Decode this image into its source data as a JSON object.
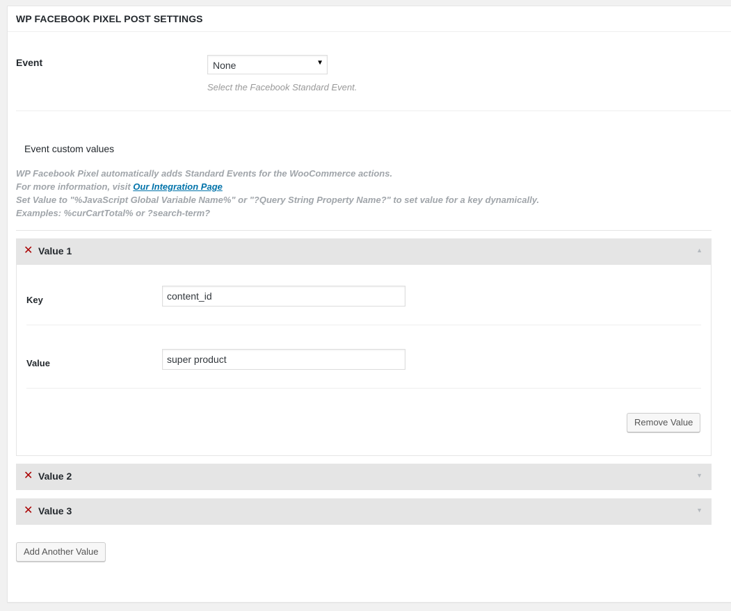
{
  "metabox": {
    "title": "WP FACEBOOK PIXEL POST SETTINGS"
  },
  "event": {
    "label": "Event",
    "selected": "None",
    "description": "Select the Facebook Standard Event."
  },
  "custom_values": {
    "heading": "Event custom values",
    "info_line1": "WP Facebook Pixel automatically adds Standard Events for the WooCommerce actions.",
    "info_line2_prefix": "For more information, visit ",
    "info_link": "Our Integration Page",
    "info_line3": "Set Value to \"%JavaScript Global Variable Name%\" or \"?Query String Property Name?\" to set value for a key dynamically.",
    "info_line4": "Examples: %curCartTotal% or ?search-term?"
  },
  "values": [
    {
      "title": "Value 1",
      "expanded": true,
      "key_label": "Key",
      "key_value": "content_id",
      "value_label": "Value",
      "value_value": "super product",
      "remove_label": "Remove Value"
    },
    {
      "title": "Value 2",
      "expanded": false
    },
    {
      "title": "Value 3",
      "expanded": false
    }
  ],
  "add_button_label": "Add Another Value",
  "icons": {
    "remove": "close-icon",
    "toggle_up": "caret-up-icon",
    "toggle_down": "caret-down-icon",
    "select_arrow": "chevron-down-icon"
  },
  "glyphs": {
    "remove": "✕",
    "up": "▲",
    "down": "▼",
    "select_arrow": "▼"
  },
  "colors": {
    "remove": "#aa0000",
    "link": "#0073aa",
    "accordion_header": "#e5e5e5"
  }
}
